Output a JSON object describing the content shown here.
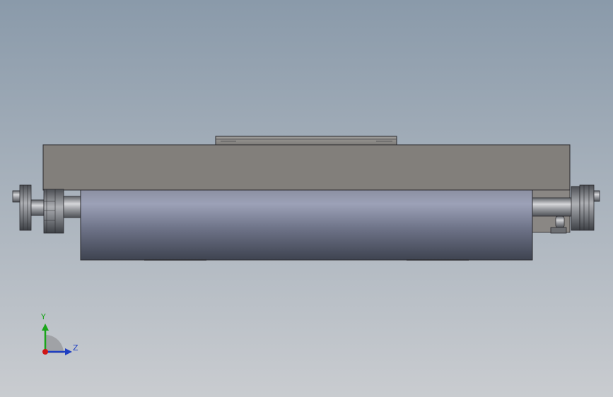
{
  "viewport": {
    "background_top": "#8a9aaa",
    "background_bottom": "#c9ccd0"
  },
  "model": {
    "frame_color": "#827f7b",
    "roller_top": "#9aa0b6",
    "roller_bottom": "#3e4350",
    "metal_light": "#c4c5c8",
    "metal_dark": "#55585d",
    "edge_color": "#2a2a2e"
  },
  "triad": {
    "y_label": "Y",
    "z_label": "Z",
    "y_color": "#1aa51a",
    "z_color": "#1f3fc2",
    "x_color": "#d01515"
  }
}
